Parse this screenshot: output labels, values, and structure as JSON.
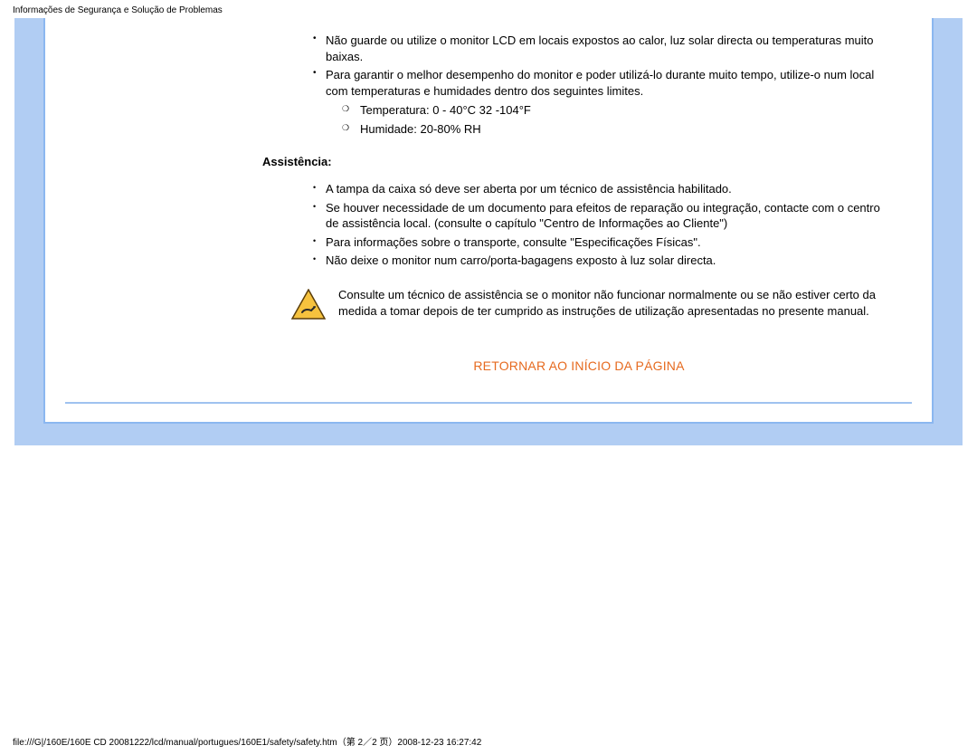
{
  "header": {
    "title": "Informações de Segurança e Solução de Problemas"
  },
  "content": {
    "top_bullets": [
      "Não guarde ou utilize o monitor LCD em locais expostos ao calor, luz solar directa ou temperaturas muito baixas.",
      "Para garantir o melhor desempenho do monitor e poder utilizá-lo durante muito tempo, utilize-o num local com temperaturas e humidades dentro dos seguintes limites."
    ],
    "sub_bullets": [
      "Temperatura: 0 - 40°C 32 -104°F",
      "Humidade: 20-80% RH"
    ],
    "section_heading": "Assistência:",
    "assist_bullets": [
      "A tampa da caixa só deve ser aberta por um técnico de assistência habilitado.",
      "Se houver necessidade de um documento para efeitos de reparação ou integração, contacte com o centro de assistência local. (consulte o capítulo \"Centro de Informações ao Cliente\")",
      "Para informações sobre o transporte, consulte \"Especificações Físicas\".",
      "Não deixe o monitor num carro/porta-bagagens exposto à luz solar directa."
    ],
    "warning_text": "Consulte um técnico de assistência se o monitor não funcionar normalmente ou se não estiver certo da medida a tomar depois de ter cumprido as instruções de utilização apresentadas no presente manual.",
    "return_link": "RETORNAR AO INÍCIO DA PÁGINA"
  },
  "footer": {
    "path": "file:///G|/160E/160E CD 20081222/lcd/manual/portugues/160E1/safety/safety.htm（第 2／2 页）2008-12-23 16:27:42"
  },
  "icons": {
    "warning": "warning-triangle-icon"
  },
  "colors": {
    "panel_bg": "#b1cdf3",
    "card_border": "#8bb7f0",
    "link": "#e66a1f"
  }
}
